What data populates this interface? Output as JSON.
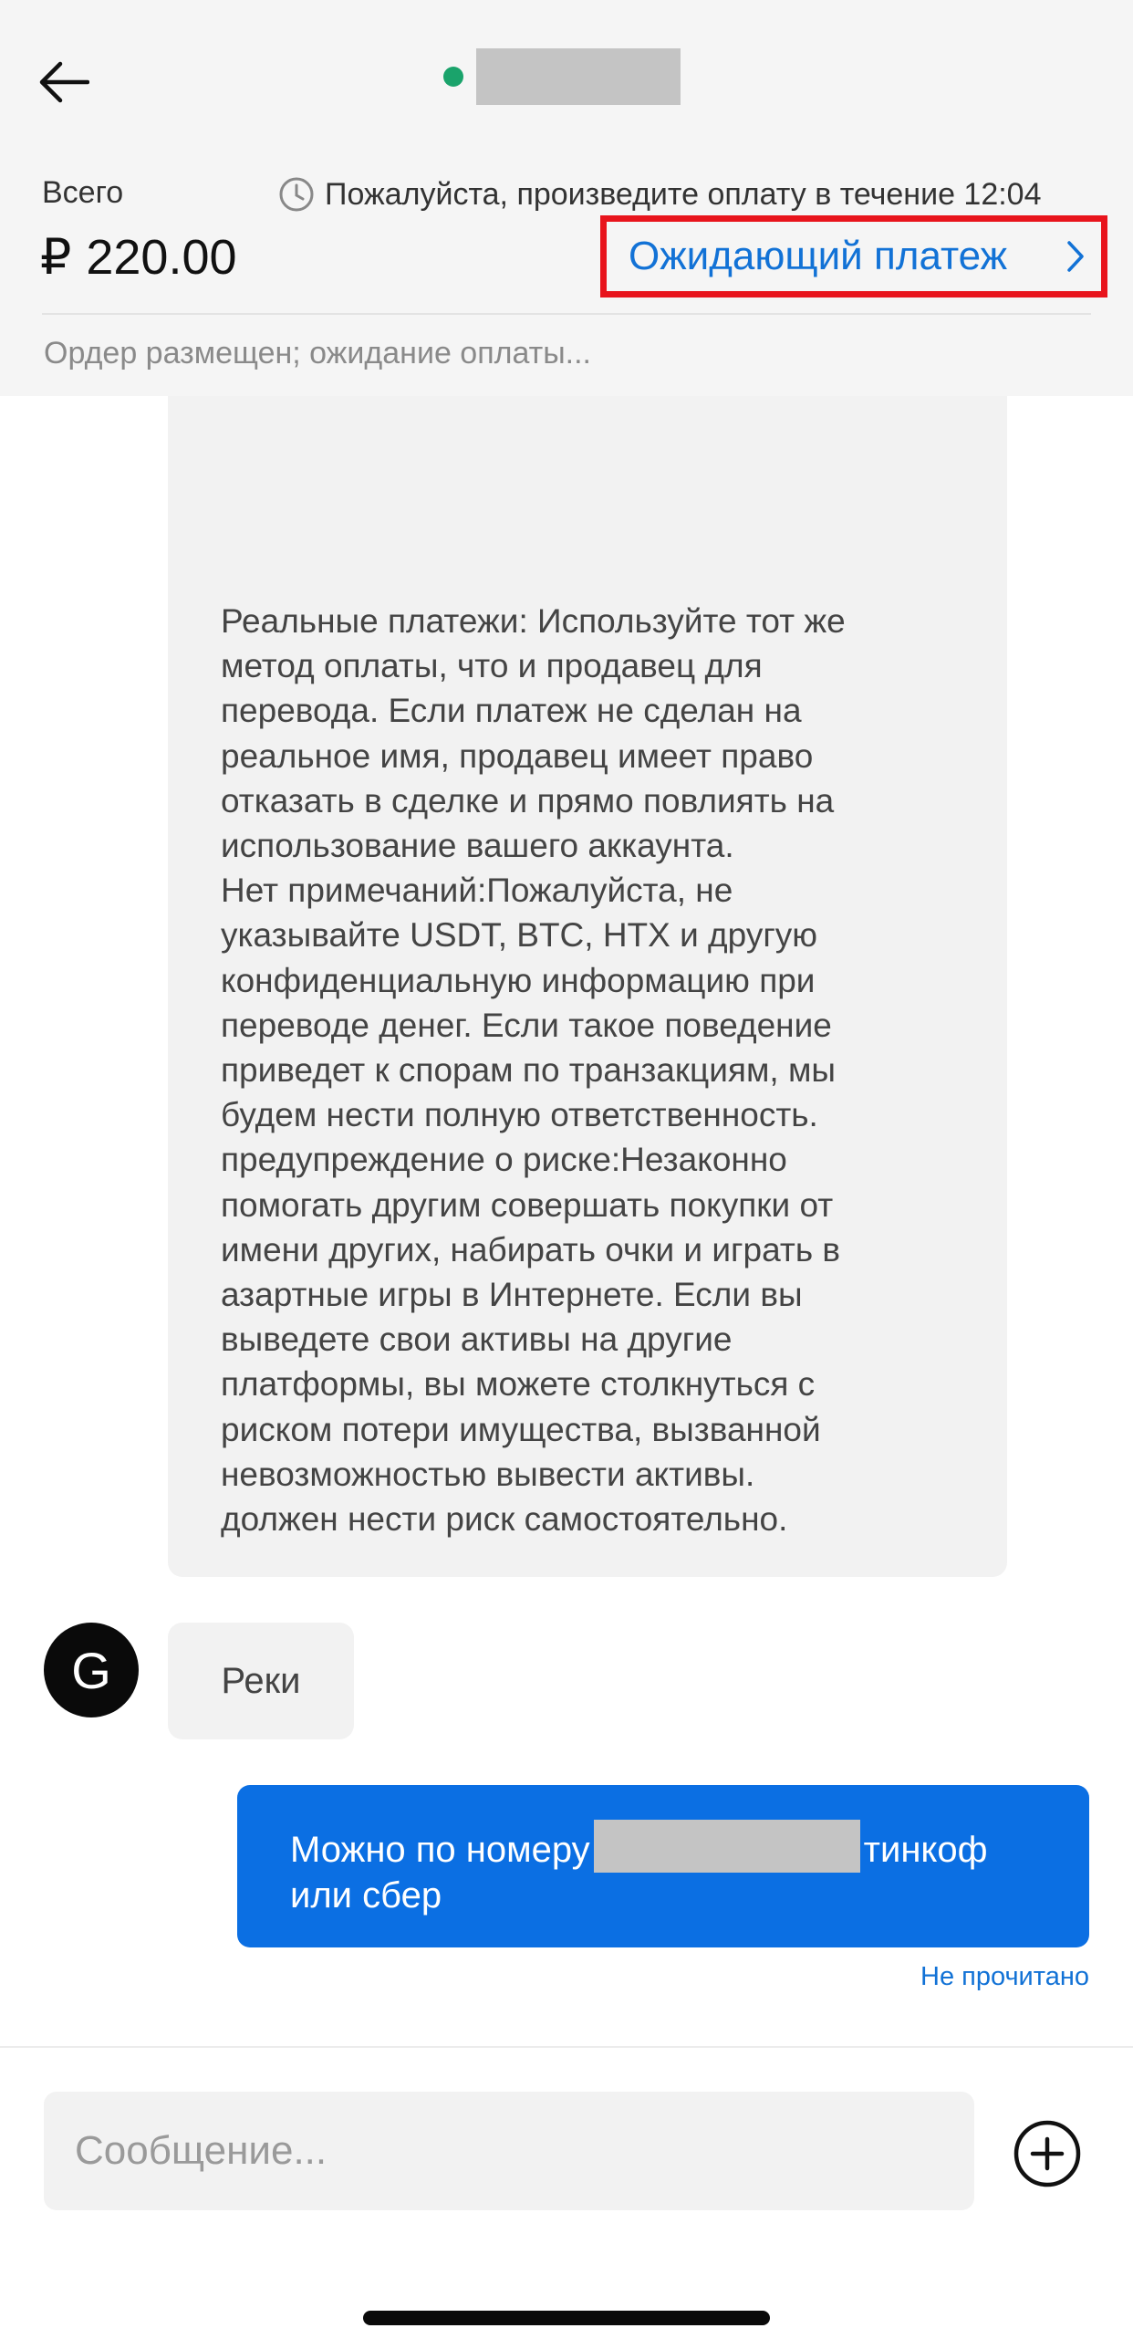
{
  "header": {
    "back_icon": "arrow-left-icon",
    "online_status_color": "#1aa36b",
    "total_label": "Всего",
    "timer_icon": "clock-icon",
    "timer_text": "Пожалуйста, произведите оплату в течение 12:04",
    "currency_symbol": "₽",
    "amount": "220.00",
    "pending_payment_label": "Ожидающий платеж",
    "pending_chevron_icon": "chevron-right-icon",
    "order_status": "Ордер размещен; ожидание оплаты..."
  },
  "chat": {
    "system_message": "Реальные платежи: Используйте тот же\nметод оплаты, что и продавец для\nперевода. Если платеж не сделан на\nреальное имя, продавец имеет право\nотказать в сделке и прямо повлиять на\nиспользование вашего аккаунта.\nНет примечаний:Пожалуйста, не\nуказывайте USDT, BTC, HTX и другую\nконфиденциальную информацию при\nпереводе денег. Если такое поведение\nприведет к спорам по транзакциям, мы\nбудем нести полную ответственность.\nпредупреждение о риске:Незаконно\nпомогать другим совершать покупки от\nимени других, набирать очки и играть в\nазартные игры в Интернете. Если вы\nвыведете свои активы на другие\nплатформы, вы можете столкнуться с\nриском потери имущества, вызванной\nневозможностью вывести активы.\nдолжен нести риск самостоятельно.",
    "incoming": {
      "avatar_letter": "G",
      "text": "Реки"
    },
    "outgoing": {
      "text_before": "Можно по номеру",
      "text_after": "тинкоф",
      "line2": "или сбер",
      "status": "Не прочитано"
    }
  },
  "composer": {
    "placeholder": "Сообщение...",
    "add_icon": "plus-circle-icon"
  },
  "colors": {
    "accent_blue": "#1272d6",
    "outgoing_bubble": "#0b6fe3",
    "highlight_red": "#e8141c"
  }
}
